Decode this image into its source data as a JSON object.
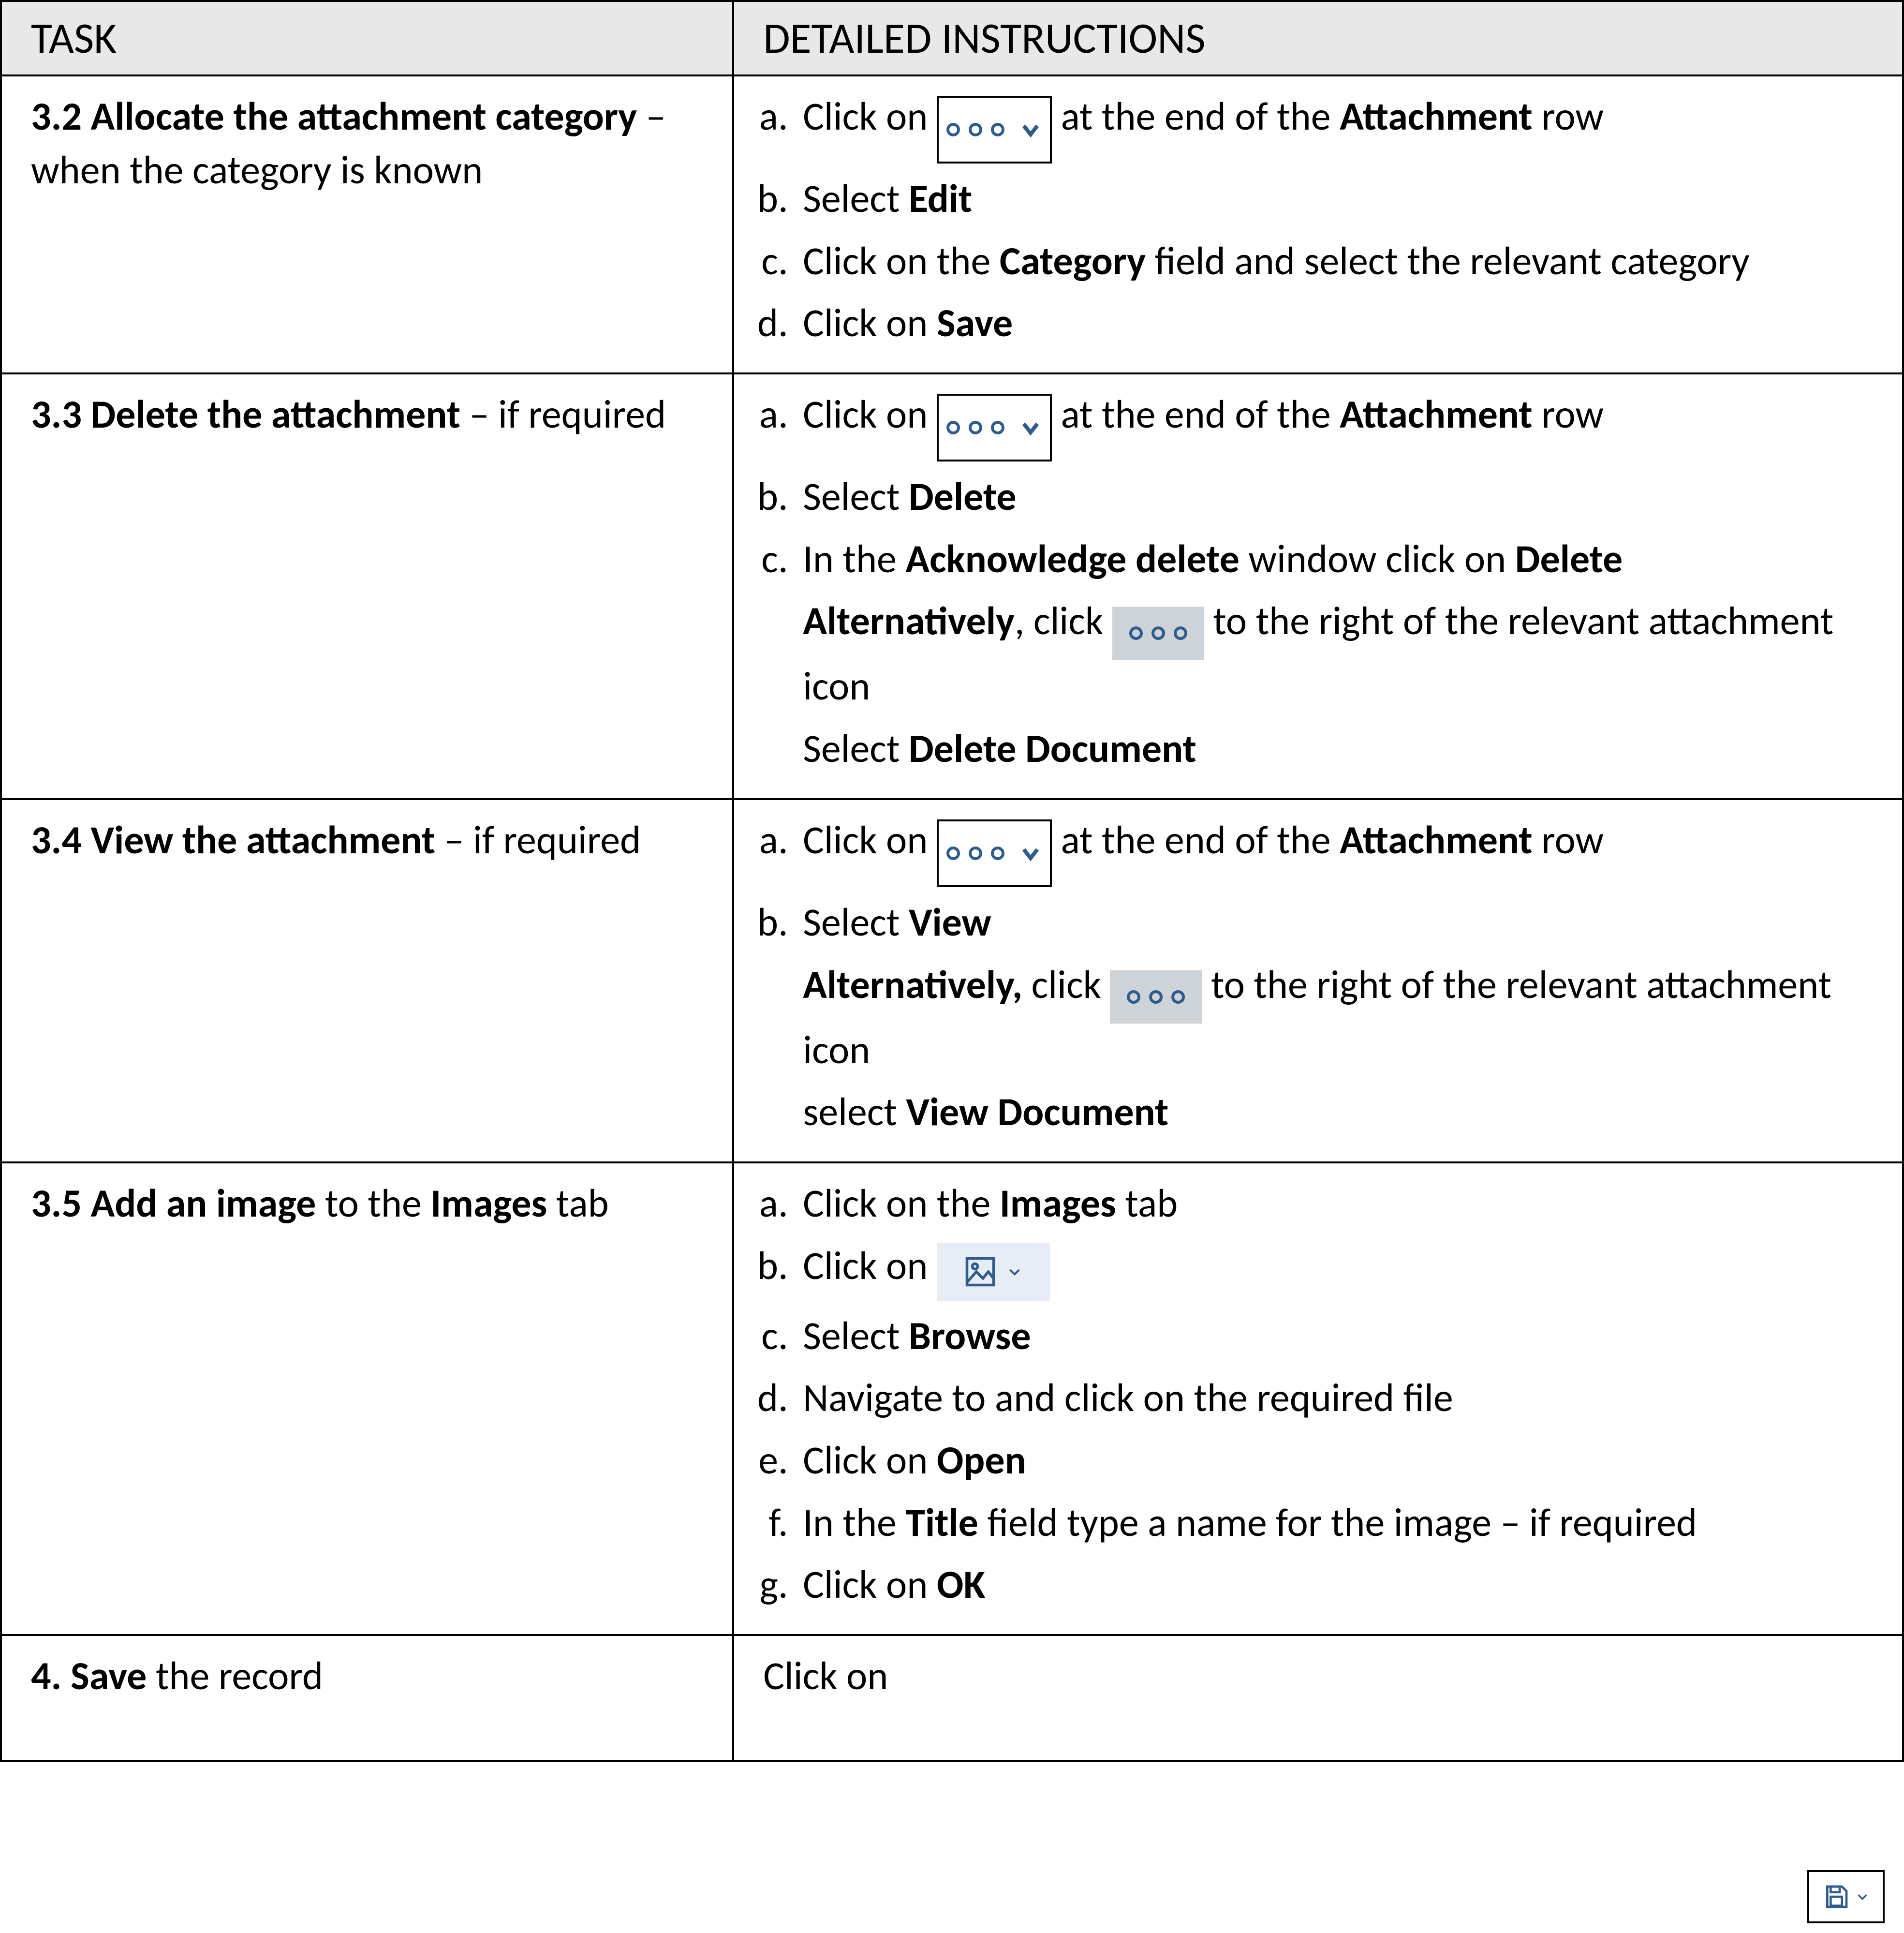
{
  "header": {
    "task": "TASK",
    "instructions": "DETAILED INSTRUCTIONS"
  },
  "rows": [
    {
      "task_html": "<span class='task-heading'>3.2 Allocate the attachment category</span> &ndash; when the category is known",
      "inst": [
        {
          "li": "a.",
          "html": "Click on <span class='badge' data-name='more-dropdown-badge' data-interactable='false'><span class='tri-dot'><span></span><span></span><span></span></span><svg width='48' height='48' viewBox='0 0 24 24' fill='none' stroke='#2f5c8c' stroke-width='4' data-name='chevron-down-icon'><polyline points='5,8 12,17 19,8'/></svg></span> at the end of the <b>Attachment</b> row"
        },
        {
          "li": "b.",
          "html": "Select <b>Edit</b>"
        },
        {
          "li": "c.",
          "html": "Click on the <b>Category</b> field and select the relevant category"
        },
        {
          "li": "d.",
          "html": "Click on <b>Save</b>"
        }
      ]
    },
    {
      "task_html": "<span class='task-heading'>3.3 Delete the attachment</span> &ndash; if required",
      "inst": [
        {
          "li": "a.",
          "html": "Click on <span class='badge' data-name='more-dropdown-badge' data-interactable='false'><span class='tri-dot'><span></span><span></span><span></span></span><svg width='48' height='48' viewBox='0 0 24 24' fill='none' stroke='#2f5c8c' stroke-width='4' data-name='chevron-down-icon'><polyline points='5,8 12,17 19,8'/></svg></span> at the end of the <b>Attachment</b> row"
        },
        {
          "li": "b.",
          "html": "Select <b>Delete</b>"
        },
        {
          "li": "c.",
          "html": "In the <b>Acknowledge delete</b> window click on <b>Delete</b>",
          "sub": [
            {
              "html": "<b>Alternatively</b>, click   <span class='badge-small-grey' data-name='more-badge' data-interactable='false'><span class='tri-dot'><span></span><span></span><span></span></span></span>   to the right of the relevant attachment icon"
            },
            {
              "html": "Select <b>Delete Document</b>"
            }
          ]
        }
      ]
    },
    {
      "task_html": "<span class='task-heading'>3.4 View the attachment</span> &ndash; if required",
      "inst": [
        {
          "li": "a.",
          "html": "Click on <span class='badge' data-name='more-dropdown-badge' data-interactable='false'><span class='tri-dot'><span></span><span></span><span></span></span><svg width='48' height='48' viewBox='0 0 24 24' fill='none' stroke='#2f5c8c' stroke-width='4' data-name='chevron-down-icon'><polyline points='5,8 12,17 19,8'/></svg></span> at the end of the <b>Attachment</b> row"
        },
        {
          "li": "b.",
          "html": "Select <b>View</b>",
          "sub": [
            {
              "html": "<b>Alternatively,</b> click <span class='badge-small-grey' data-name='more-badge' data-interactable='false'><span class='tri-dot'><span></span><span></span><span></span></span></span>   to the right of the relevant attachment icon"
            },
            {
              "html": "select <b>View Document</b>"
            }
          ]
        }
      ]
    },
    {
      "task_html": "<span class='task-heading'>3.5 Add an image</span> to the <b>Images</b> tab",
      "inst": [
        {
          "li": "a.",
          "html": "Click on the <b>Images</b> tab"
        },
        {
          "li": "b.",
          "html": "Click on <span class='badge-picture' data-name='picture-dropdown-badge' data-interactable='false'><svg class='pic' viewBox='0 0 24 24' fill='none' stroke='#2f5c8c' stroke-width='2' data-name='picture-icon'><rect x='2' y='2' width='20' height='20'/><circle cx='8' cy='8' r='2'/><polyline points='2,20 9,12 14,17 18,12 22,17'/></svg><svg width='32' height='32' viewBox='0 0 24 24' fill='none' stroke='#2f5c8c' stroke-width='3' data-name='chevron-down-icon'><polyline points='5,9 12,16 19,9'/></svg></span>"
        },
        {
          "li": "c.",
          "html": "Select<b> Browse</b>"
        },
        {
          "li": "d.",
          "html": "Navigate to and click on the required file"
        },
        {
          "li": "e.",
          "html": "Click on <b>Open</b>"
        },
        {
          "li": "f.",
          "html": "In the <b>Title</b> field type a name for the image &ndash; if required"
        },
        {
          "li": "g.",
          "html": "Click on <b>OK</b>"
        }
      ]
    }
  ],
  "bottom_row": {
    "task_html": "<span class='task-heading'>4. Save</span> the record",
    "inst_html": "Click on &nbsp;<span class='footer-inline'></span>"
  }
}
